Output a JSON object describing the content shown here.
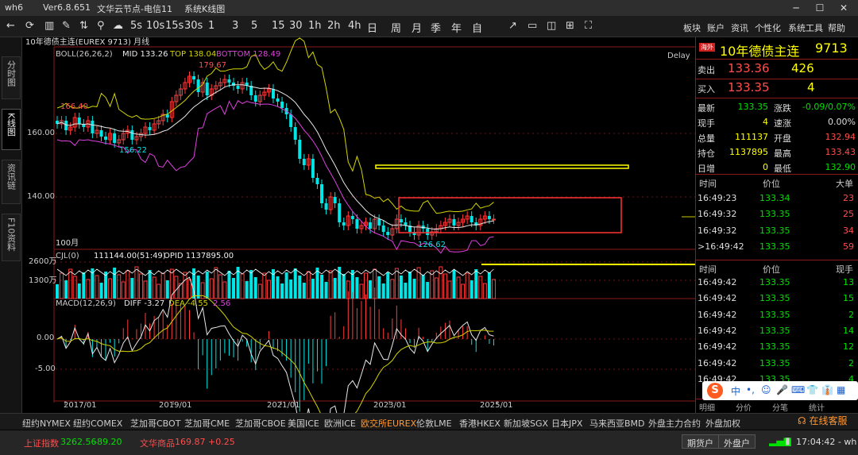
{
  "titlebar": {
    "app": "wh6",
    "version": "Ver6.8.651",
    "node": "文华云节点-电信11",
    "view": "系统K线图"
  },
  "toolbar": {
    "periods": [
      "5s",
      "10s",
      "15s",
      "30s",
      "1",
      "3",
      "5",
      "15",
      "30",
      "1h",
      "2h",
      "4h",
      "日",
      "周",
      "月",
      "季",
      "年",
      "自"
    ],
    "right_items": [
      "板块",
      "账户",
      "资讯",
      "个性化",
      "系统工具",
      "帮助"
    ]
  },
  "leftbar": {
    "tabs": [
      "分时图",
      "K线图",
      "资讯链",
      "F10资料"
    ]
  },
  "chart": {
    "header": "10年德债主连(EUREX 9713) 月线",
    "boll": {
      "label": "BOLL(26,26,2)",
      "mid": "MID 133.26",
      "top": "TOP 138.04",
      "bottom": "BOTTOM 128.49"
    },
    "delay": "Delay",
    "price_ticks": [
      "160.00",
      "140.00"
    ],
    "annotations": {
      "high": "179.67",
      "mid_high": "166.40",
      "low1": "156.22",
      "low2": "126.62",
      "bars": "100月"
    },
    "volume": {
      "label": "CJL(0)",
      "values": "111144.00(51:49)",
      "opid": "OPID 1137895.00",
      "ticks": [
        "2600万",
        "1300万"
      ]
    },
    "macd": {
      "label": "MACD(12,26,9)",
      "diff": "DIFF -3.27",
      "dea": "DEA -4.55",
      "macd": "2.56",
      "ticks": [
        "0.00",
        "-5.00"
      ]
    },
    "x_ticks": [
      "2017/01",
      "2019/01",
      "2021/01",
      "2023/01",
      "2025/01"
    ]
  },
  "colors": {
    "up": "#ff3b3b",
    "down": "#00e5e5",
    "boll_mid": "#e8e8e8",
    "boll_top": "#d4d400",
    "boll_bottom": "#e040e0",
    "annot_box": "#ff3333",
    "annot_line": "#ffff00"
  },
  "panel": {
    "badge": "海外",
    "title": "10年德债主连",
    "code": "9713",
    "sell": {
      "label": "卖出",
      "price": "133.36",
      "vol": "426"
    },
    "buy": {
      "label": "买入",
      "price": "133.35",
      "vol": "4"
    },
    "stats": [
      {
        "l1": "最新",
        "v1": "133.35",
        "l2": "涨跌",
        "v2": "-0.09/0.07%"
      },
      {
        "l1": "现手",
        "v1": "4",
        "l2": "速涨",
        "v2": "0.00%"
      },
      {
        "l1": "总量",
        "v1": "111137",
        "l2": "开盘",
        "v2": "132.94"
      },
      {
        "l1": "持仓",
        "v1": "1137895",
        "l2": "最高",
        "v2": "133.43"
      },
      {
        "l1": "日增",
        "v1": "0",
        "l2": "最低",
        "v2": "132.90"
      }
    ],
    "big_header": [
      "时间",
      "价位",
      "大单"
    ],
    "big": [
      {
        "t": "16:49:23",
        "p": "133.34",
        "v": "23"
      },
      {
        "t": "16:49:32",
        "p": "133.35",
        "v": "25"
      },
      {
        "t": "16:49:32",
        "p": "133.35",
        "v": "34"
      },
      {
        "t": ">16:49:42",
        "p": "133.35",
        "v": "59"
      }
    ],
    "tick_header": [
      "时间",
      "价位",
      "现手"
    ],
    "ticks": [
      {
        "t": "16:49:42",
        "p": "133.35",
        "v": "13"
      },
      {
        "t": "16:49:42",
        "p": "133.35",
        "v": "15"
      },
      {
        "t": "16:49:42",
        "p": "133.35",
        "v": "2"
      },
      {
        "t": "16:49:42",
        "p": "133.35",
        "v": "14"
      },
      {
        "t": "16:49:42",
        "p": "133.35",
        "v": "12"
      },
      {
        "t": "16:49:42",
        "p": "133.35",
        "v": "2"
      },
      {
        "t": "16:49:42",
        "p": "133.35",
        "v": "4"
      }
    ],
    "bottom_tabs": [
      "明细",
      "分价",
      "分笔",
      "统计"
    ]
  },
  "bottom_tabs": [
    "纽约NYMEX",
    "纽约COMEX",
    "芝加哥CBOT",
    "芝加哥CME",
    "芝加哥CBOE",
    "美国ICE",
    "欧洲ICE",
    "欧交所EUREX",
    "伦敦LME",
    "香港HKEX",
    "新加坡SGX",
    "日本JPX",
    "马来西亚BMD",
    "外盘主力合约",
    "外盘加权"
  ],
  "active_bottom_tab": "欧交所EUREX",
  "status": {
    "idx1_name": "上证指数",
    "idx1_val": "3262.56",
    "idx1_chg": "-89.20",
    "idx2_name": "文华商品",
    "idx2_val": "169.87",
    "idx2_chg": "+0.25",
    "btn1": "期货户",
    "btn2": "外盘户",
    "time": "17:04:42 - wh",
    "service": "在线客服"
  },
  "ime": {
    "items": [
      "中",
      "•,",
      "☺",
      "🎤",
      "⌨",
      "👕",
      "👔",
      "▦"
    ]
  }
}
